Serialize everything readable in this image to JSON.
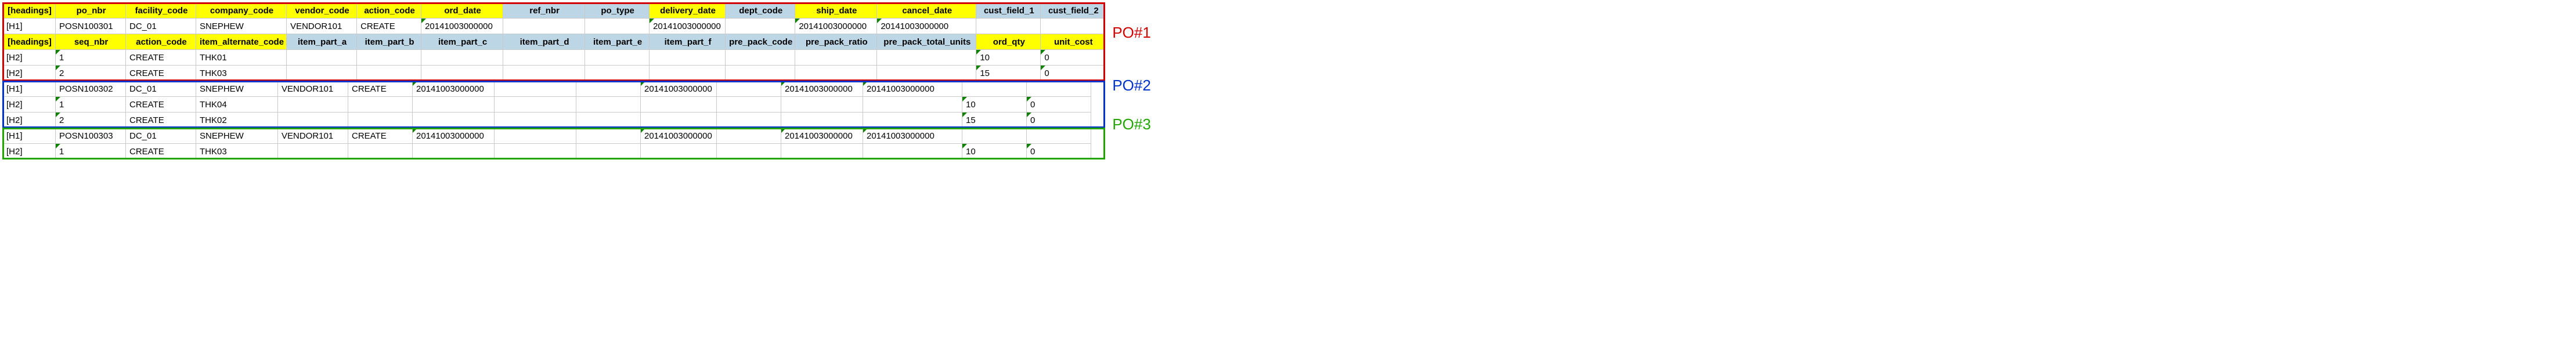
{
  "groups": [
    {
      "label": "PO#1",
      "header1": [
        "[headings]",
        "po_nbr",
        "facility_code",
        "company_code",
        "vendor_code",
        "action_code",
        "ord_date",
        "ref_nbr",
        "po_type",
        "delivery_date",
        "dept_code",
        "ship_date",
        "cancel_date",
        "cust_field_1",
        "cust_field_2"
      ],
      "header1_style": [
        "hdr",
        "hdr",
        "hdr",
        "hdr",
        "hdr",
        "hdr",
        "hdr",
        "hdr-blue",
        "hdr-blue",
        "hdr",
        "hdr-blue",
        "hdr",
        "hdr",
        "hdr-blue",
        "hdr-blue"
      ],
      "h1_row": [
        "[H1]",
        "POSN100301",
        "DC_01",
        "SNEPHEW",
        "VENDOR101",
        "CREATE",
        "20141003000000",
        "",
        "",
        "20141003000000",
        "",
        "20141003000000",
        "20141003000000",
        "",
        ""
      ],
      "header2": [
        "[headings]",
        "seq_nbr",
        "action_code",
        "item_alternate_code",
        "item_part_a",
        "item_part_b",
        "item_part_c",
        "item_part_d",
        "item_part_e",
        "item_part_f",
        "pre_pack_code",
        "pre_pack_ratio",
        "pre_pack_total_units",
        "ord_qty",
        "unit_cost"
      ],
      "header2_style": [
        "hdr",
        "hdr",
        "hdr",
        "hdr",
        "hdr-blue",
        "hdr-blue",
        "hdr-blue",
        "hdr-blue",
        "hdr-blue",
        "hdr-blue",
        "hdr-blue",
        "hdr-blue",
        "hdr-blue",
        "hdr",
        "hdr"
      ],
      "h2_rows": [
        [
          "[H2]",
          "1",
          "CREATE",
          "THK01",
          "",
          "",
          "",
          "",
          "",
          "",
          "",
          "",
          "",
          "10",
          "0"
        ],
        [
          "[H2]",
          "2",
          "CREATE",
          "THK03",
          "",
          "",
          "",
          "",
          "",
          "",
          "",
          "",
          "",
          "15",
          "0"
        ]
      ]
    },
    {
      "label": "PO#2",
      "h1_row": [
        "[H1]",
        "POSN100302",
        "DC_01",
        "SNEPHEW",
        "VENDOR101",
        "CREATE",
        "20141003000000",
        "",
        "",
        "20141003000000",
        "",
        "20141003000000",
        "20141003000000",
        "",
        ""
      ],
      "h2_rows": [
        [
          "[H2]",
          "1",
          "CREATE",
          "THK04",
          "",
          "",
          "",
          "",
          "",
          "",
          "",
          "",
          "",
          "10",
          "0"
        ],
        [
          "[H2]",
          "2",
          "CREATE",
          "THK02",
          "",
          "",
          "",
          "",
          "",
          "",
          "",
          "",
          "",
          "15",
          "0"
        ]
      ]
    },
    {
      "label": "PO#3",
      "h1_row": [
        "[H1]",
        "POSN100303",
        "DC_01",
        "SNEPHEW",
        "VENDOR101",
        "CREATE",
        "20141003000000",
        "",
        "",
        "20141003000000",
        "",
        "20141003000000",
        "20141003000000",
        "",
        ""
      ],
      "h2_rows": [
        [
          "[H2]",
          "1",
          "CREATE",
          "THK03",
          "",
          "",
          "",
          "",
          "",
          "",
          "",
          "",
          "",
          "10",
          "0"
        ]
      ]
    }
  ],
  "green_tri_h1_cols": [
    6,
    9,
    11,
    12
  ],
  "green_tri_h2_cols": [
    1,
    13,
    14
  ]
}
